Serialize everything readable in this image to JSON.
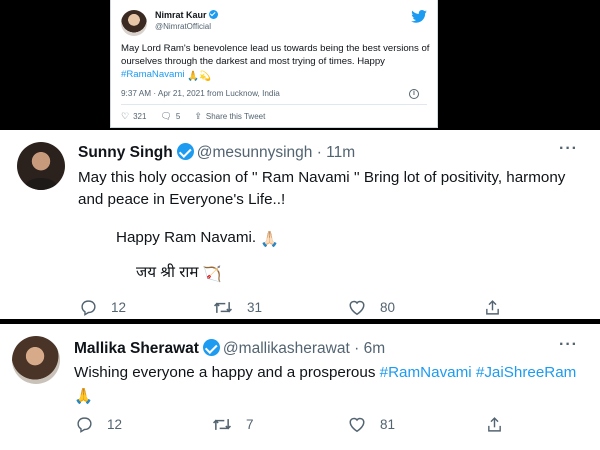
{
  "embed": {
    "name": "Nimrat Kaur",
    "handle": "@NimratOfficial",
    "text": "May Lord Ram's benevolence lead us towards being the best versions of ourselves through the darkest and most trying of times. Happy ",
    "hashtag": "#RamaNavami",
    "emoji": "🙏💫",
    "meta": "9:37 AM · Apr 21, 2021 from Lucknow, India",
    "likes": "321",
    "replies": "5",
    "share": "Share this Tweet"
  },
  "sunny": {
    "name": "Sunny Singh",
    "handle": "@mesunnysingh",
    "time": "· 11m",
    "line1": "May this holy occasion of '' Ram Navami '' Bring lot of positivity, harmony",
    "line2": "and peace in Everyone's Life..!",
    "line3": "Happy Ram Navami.",
    "line3_emoji": "🙏🏻",
    "line4": "जय श्री राम",
    "line4_emoji": "🏹",
    "replies": "12",
    "retweets": "31",
    "likes": "80"
  },
  "mallika": {
    "name": "Mallika Sherawat",
    "handle": "@mallikasherawat",
    "time": "· 6m",
    "text": "Wishing everyone a happy and a prosperous ",
    "tag1": "#RamNavami",
    "tag2": "#JaiShreeRam",
    "emoji": "🙏",
    "replies": "12",
    "retweets": "7",
    "likes": "81"
  },
  "colors": {
    "accent": "#1d9bf0",
    "text": "#0f1419",
    "muted": "#536471"
  }
}
